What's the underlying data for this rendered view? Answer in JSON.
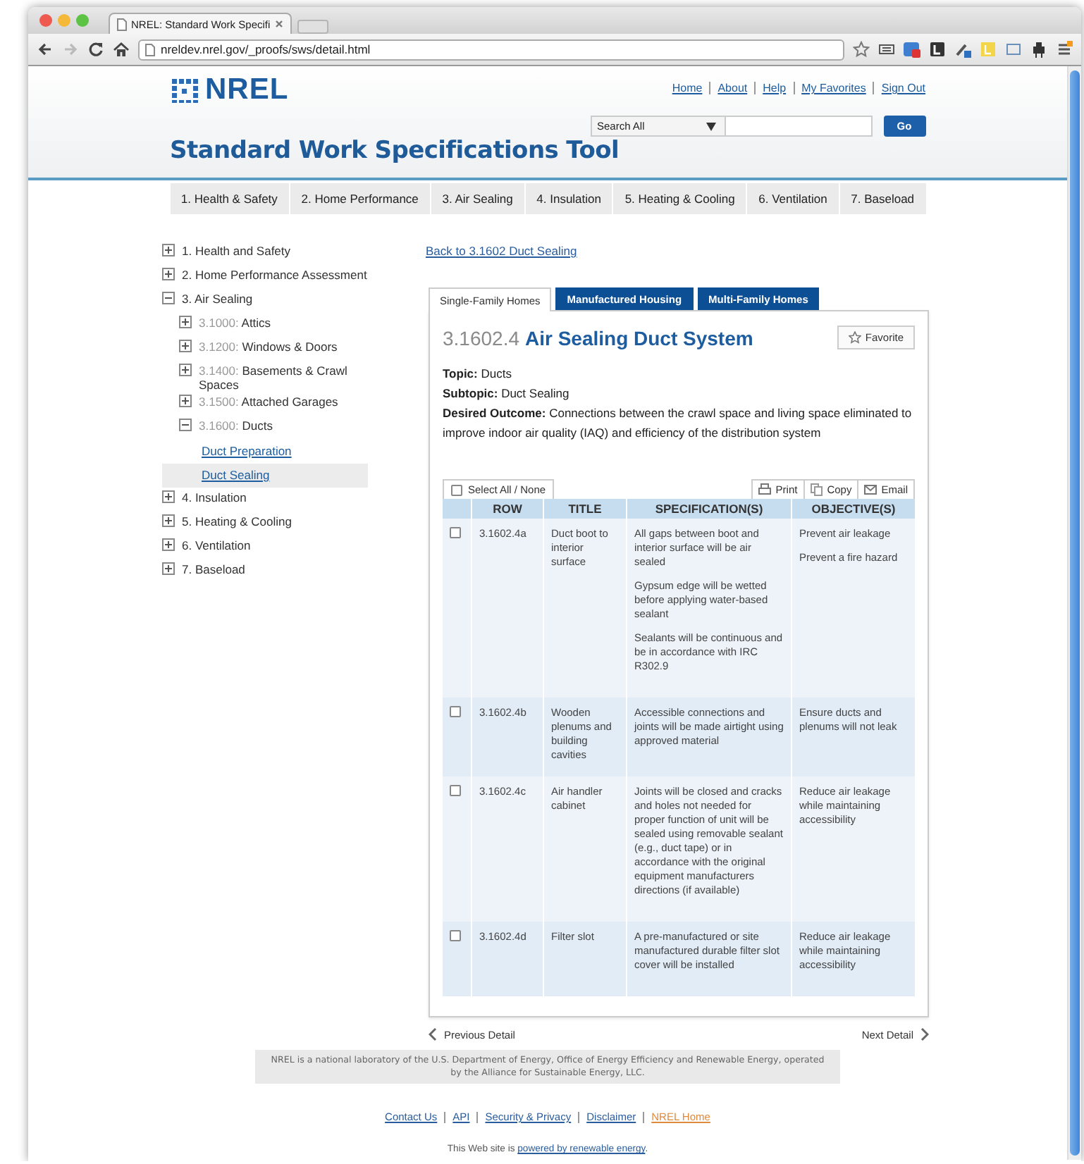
{
  "browser": {
    "tab_title": "NREL: Standard Work Specifi",
    "url": "nreldev.nrel.gov/_proofs/sws/detail.html"
  },
  "header": {
    "logo": "NREL",
    "links": [
      "Home",
      "About",
      "Help",
      "My Favorites",
      "Sign Out"
    ],
    "search": {
      "scope": "Search All",
      "button": "Go"
    },
    "title": "Standard Work Specifications Tool"
  },
  "nav": [
    {
      "label": "1. Health & Safety",
      "selected": false
    },
    {
      "label": "2. Home Performance",
      "selected": false
    },
    {
      "label": "3. Air Sealing",
      "selected": false
    },
    {
      "label": "4. Insulation",
      "selected": false
    },
    {
      "label": "5. Heating & Cooling",
      "selected": false
    },
    {
      "label": "6. Ventilation",
      "selected": false
    },
    {
      "label": "7. Baseload",
      "selected": false
    }
  ],
  "tree": {
    "items": [
      {
        "kind": "folder",
        "label": "1. Health and Safety",
        "expanded": false
      },
      {
        "kind": "folder",
        "label": "2. Home Performance Assessment",
        "expanded": false
      },
      {
        "kind": "folder",
        "label": "3. Air Sealing",
        "expanded": true,
        "children": [
          {
            "kind": "folder",
            "number": "3.1000:",
            "label": "Attics",
            "expanded": false
          },
          {
            "kind": "folder",
            "number": "3.1200:",
            "label": "Windows & Doors",
            "expanded": false
          },
          {
            "kind": "folder",
            "number": "3.1400:",
            "label": "Basements & Crawl Spaces",
            "expanded": false
          },
          {
            "kind": "folder",
            "number": "3.1500:",
            "label": "Attached Garages",
            "expanded": false
          },
          {
            "kind": "folder",
            "number": "3.1600:",
            "label": "Ducts",
            "expanded": true,
            "children": [
              {
                "kind": "link",
                "label": "Duct Preparation",
                "selected": false
              },
              {
                "kind": "link",
                "label": "Duct Sealing",
                "selected": true
              }
            ]
          }
        ]
      },
      {
        "kind": "folder",
        "label": "4. Insulation",
        "expanded": false
      },
      {
        "kind": "folder",
        "label": "5. Heating & Cooling",
        "expanded": false
      },
      {
        "kind": "folder",
        "label": "6. Ventilation",
        "expanded": false
      },
      {
        "kind": "folder",
        "label": "7. Baseload",
        "expanded": false
      }
    ]
  },
  "back_link": "Back to 3.1602 Duct Sealing",
  "home_types": [
    {
      "label": "Single-Family Homes",
      "selected": true
    },
    {
      "label": "Manufactured Housing",
      "selected": false
    },
    {
      "label": "Multi-Family Homes",
      "selected": false
    }
  ],
  "detail": {
    "number": "3.1602.4",
    "title": "Air Sealing Duct System",
    "favorite": "Favorite",
    "fields": [
      {
        "label": "Topic:",
        "value": "Ducts"
      },
      {
        "label": "Subtopic:",
        "value": "Duct Sealing"
      },
      {
        "label": "Desired Outcome:",
        "value": "Connections between the crawl space and living space eliminated to improve indoor air quality (IAQ) and efficiency of the distribution system"
      }
    ]
  },
  "table": {
    "select_all": {
      "label": "Select All / None",
      "checked": false
    },
    "actions": [
      {
        "kind": "print",
        "label": "Print"
      },
      {
        "kind": "copy",
        "label": "Copy"
      },
      {
        "kind": "email",
        "label": "Email"
      }
    ],
    "columns": [
      "ROW",
      "TITLE",
      "SPECIFICATION(S)",
      "OBJECTIVE(S)"
    ],
    "rows": [
      {
        "checked": false,
        "row": "3.1602.4a",
        "title": "Duct boot to interior surface",
        "specifications": [
          "All gaps between boot and interior surface will be air sealed",
          "Gypsum edge will be wetted before applying water-based sealant",
          "Sealants will be continuous and be in accordance with IRC R302.9"
        ],
        "objectives": [
          "Prevent air leakage",
          "Prevent a fire hazard"
        ]
      },
      {
        "checked": false,
        "row": "3.1602.4b",
        "title": "Wooden plenums and building cavities",
        "specifications": [
          "Accessible connections and joints will be made airtight using approved material"
        ],
        "objectives": [
          "Ensure ducts and plenums will not leak"
        ]
      },
      {
        "checked": false,
        "row": "3.1602.4c",
        "title": "Air handler cabinet",
        "specifications": [
          "Joints will be closed and cracks and holes not needed for proper function of unit will be sealed using removable sealant (e.g., duct tape) or in accordance with the original equipment manufacturers directions (if available)"
        ],
        "objectives": [
          "Reduce air leakage while maintaining accessibility"
        ]
      },
      {
        "checked": false,
        "row": "3.1602.4d",
        "title": "Filter slot",
        "specifications": [
          "A pre-manufactured or site manufactured durable filter slot cover will be installed"
        ],
        "objectives": [
          "Reduce air leakage while maintaining accessibility"
        ]
      }
    ]
  },
  "pager": {
    "previous": "Previous Detail",
    "next": "Next Detail"
  },
  "footer": {
    "notice": "NREL is a national laboratory of the U.S. Department of Energy, Office of Energy Efficiency and Renewable Energy, operated by the Alliance for Sustainable Energy, LLC.",
    "links": [
      {
        "label": "Contact Us",
        "kind": "normal"
      },
      {
        "label": "API",
        "kind": "normal"
      },
      {
        "label": "Security & Privacy",
        "kind": "normal"
      },
      {
        "label": "Disclaimer",
        "kind": "normal"
      },
      {
        "label": "NREL Home",
        "kind": "highlight"
      }
    ],
    "powered": {
      "prefix": "This Web site is ",
      "link": "powered by renewable energy",
      "suffix": "."
    }
  }
}
